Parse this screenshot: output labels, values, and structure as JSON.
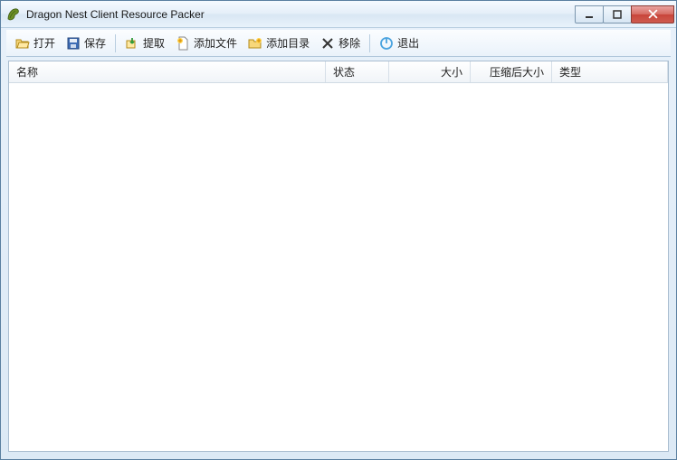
{
  "window": {
    "title": "Dragon Nest Client Resource Packer"
  },
  "toolbar": {
    "open": "打开",
    "save": "保存",
    "extract": "提取",
    "addfile": "添加文件",
    "adddir": "添加目录",
    "remove": "移除",
    "exit": "退出"
  },
  "columns": {
    "name": "名称",
    "state": "状态",
    "size": "大小",
    "csize": "压缩后大小",
    "type": "类型"
  },
  "rows": []
}
